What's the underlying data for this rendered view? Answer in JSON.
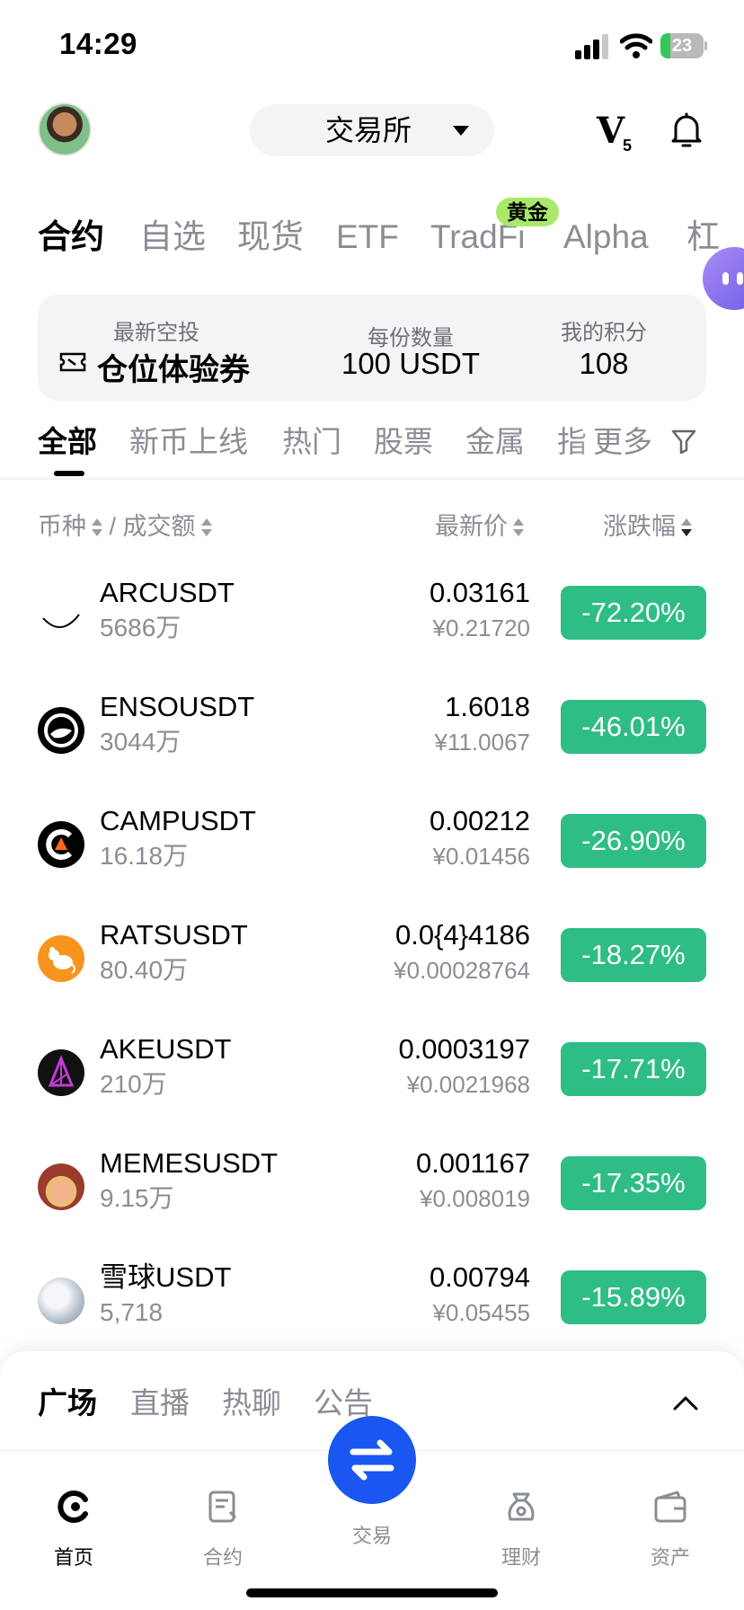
{
  "status_bar": {
    "time": "14:29",
    "battery": "23"
  },
  "header": {
    "exchange_label": "交易所",
    "vip_label": "V",
    "vip_level": "5"
  },
  "main_tabs": [
    {
      "label": "合约"
    },
    {
      "label": "自选"
    },
    {
      "label": "现货"
    },
    {
      "label": "ETF"
    },
    {
      "label": "TradFi"
    },
    {
      "label": "Alpha"
    },
    {
      "label": "杠"
    }
  ],
  "gold_badge": "黄金",
  "promo_card": {
    "airdrop_label": "最新空投",
    "airdrop_value": "仓位体验券",
    "per_share_label": "每份数量",
    "per_share_value": "100 USDT",
    "points_label": "我的积分",
    "points_value": "108"
  },
  "sub_tabs": [
    {
      "label": "全部"
    },
    {
      "label": "新币上线"
    },
    {
      "label": "热门"
    },
    {
      "label": "股票"
    },
    {
      "label": "金属"
    },
    {
      "label": "指"
    }
  ],
  "more_label": "更多",
  "columns": {
    "symbol": "币种",
    "separator": "/",
    "turnover": "成交额",
    "price": "最新价",
    "change": "涨跌幅"
  },
  "rows": [
    {
      "symbol": "ARCUSDT",
      "volume": "5686万",
      "price": "0.03161",
      "cny": "¥0.21720",
      "change": "-72.20%",
      "icon": "arc-icon"
    },
    {
      "symbol": "ENSOUSDT",
      "volume": "3044万",
      "price": "1.6018",
      "cny": "¥11.0067",
      "change": "-46.01%",
      "icon": "enso-icon"
    },
    {
      "symbol": "CAMPUSDT",
      "volume": "16.18万",
      "price": "0.00212",
      "cny": "¥0.01456",
      "change": "-26.90%",
      "icon": "camp-icon"
    },
    {
      "symbol": "RATSUSDT",
      "volume": "80.40万",
      "price": "0.0{4}4186",
      "cny": "¥0.00028764",
      "change": "-18.27%",
      "icon": "rats-icon"
    },
    {
      "symbol": "AKEUSDT",
      "volume": "210万",
      "price": "0.0003197",
      "cny": "¥0.0021968",
      "change": "-17.71%",
      "icon": "ake-icon"
    },
    {
      "symbol": "MEMESUSDT",
      "volume": "9.15万",
      "price": "0.001167",
      "cny": "¥0.008019",
      "change": "-17.35%",
      "icon": "memes-icon"
    },
    {
      "symbol": "雪球USDT",
      "volume": "5,718",
      "price": "0.00794",
      "cny": "¥0.05455",
      "change": "-15.89%",
      "icon": "snowball-icon"
    }
  ],
  "colors": {
    "down": "#2ebd85",
    "accent": "#1a57f0",
    "badge": "#a9e96a"
  },
  "sheet_tabs": [
    {
      "label": "广场"
    },
    {
      "label": "直播"
    },
    {
      "label": "热聊"
    },
    {
      "label": "公告"
    }
  ],
  "tab_bar": [
    {
      "label": "首页",
      "icon": "home-icon"
    },
    {
      "label": "合约",
      "icon": "contract-icon"
    },
    {
      "label": "交易",
      "icon": "swap-icon"
    },
    {
      "label": "理财",
      "icon": "finance-icon"
    },
    {
      "label": "资产",
      "icon": "wallet-icon"
    }
  ]
}
